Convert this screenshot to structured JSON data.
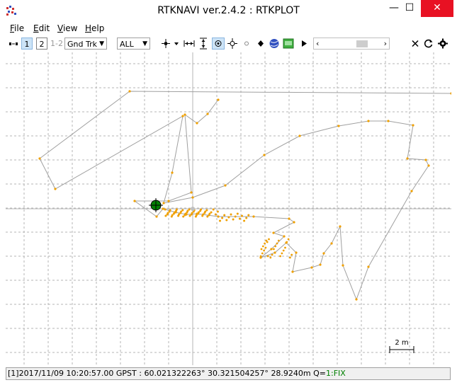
{
  "window": {
    "title": "RTKNAVI ver.2.4.2 : RTKPLOT",
    "minimize_glyph": "—",
    "maximize_glyph": "☐",
    "close_glyph": "✕"
  },
  "menu": {
    "items": [
      {
        "accel": "F",
        "rest": "ile"
      },
      {
        "accel": "E",
        "rest": "dit"
      },
      {
        "accel": "V",
        "rest": "iew"
      },
      {
        "accel": "H",
        "rest": "elp"
      }
    ]
  },
  "toolbar": {
    "mode_1": "1",
    "mode_2": "2",
    "mode_12": "1-2",
    "plot_type": "Gnd Trk",
    "quality_filter": "ALL"
  },
  "plot": {
    "scale_label": "2 m",
    "colors": {
      "grid": "#b4b4b4",
      "track_line": "#a0a0a0",
      "point": "#f0a000",
      "current_position": "#008000"
    }
  },
  "status": {
    "prefix": "[1]",
    "time": "2017/11/09 10:20:57.00 GPST",
    "lat": "60.021322263°",
    "lon": "30.321504257°",
    "height": "28.9240m",
    "q_label": "Q=",
    "fix": "1:FIX"
  }
}
